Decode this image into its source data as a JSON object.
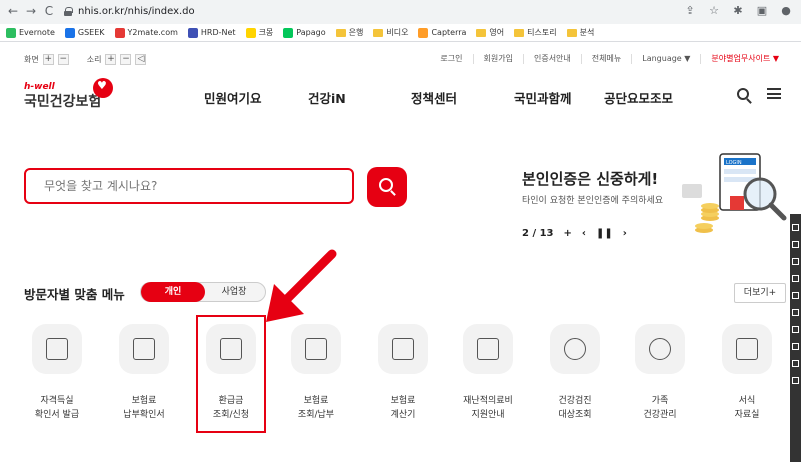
{
  "browser": {
    "back": "←",
    "forward": "→",
    "reload": "C",
    "url": "nhis.or.kr/nhis/index.do",
    "bookmarks": [
      {
        "label": "Evernote",
        "icon": "evernote-icon",
        "color": "#2dbe60"
      },
      {
        "label": "GSEEK",
        "icon": "gseek-icon",
        "color": "#1a73e8"
      },
      {
        "label": "Y2mate.com",
        "icon": "y2mate-icon",
        "color": "#e53935"
      },
      {
        "label": "HRD-Net",
        "icon": "hrdnet-icon",
        "color": "#3f51b5"
      },
      {
        "label": "크몽",
        "icon": "kmong-icon",
        "color": "#ffd400"
      },
      {
        "label": "Papago",
        "icon": "papago-icon",
        "color": "#03c75a"
      },
      {
        "label": "은행",
        "icon": "folder-icon",
        "color": "#f4c43a"
      },
      {
        "label": "비디오",
        "icon": "folder-icon",
        "color": "#f4c43a"
      },
      {
        "label": "Capterra",
        "icon": "capterra-icon",
        "color": "#ff9d28"
      },
      {
        "label": "영어",
        "icon": "folder-icon",
        "color": "#f4c43a"
      },
      {
        "label": "티스토리",
        "icon": "folder-icon",
        "color": "#f4c43a"
      },
      {
        "label": "분석",
        "icon": "folder-icon",
        "color": "#f4c43a"
      }
    ]
  },
  "util": {
    "screen_label": "화면",
    "sound_label": "소리",
    "links": [
      "로그인",
      "회원가입",
      "인증서안내",
      "전체메뉴",
      "Language ▼"
    ],
    "branch_site": "분야별업무사이트 ▼"
  },
  "header": {
    "logo_small": "h-well",
    "logo_name": "국민건강보험",
    "nav": [
      "민원여기요",
      "건강iN",
      "정책센터",
      "국민과함께",
      "공단요모조모"
    ]
  },
  "search": {
    "placeholder": "무엇을 찾고 계시나요?"
  },
  "promo": {
    "title": "본인인증은 신중하게!",
    "subtitle": "타인이 요청한 본인인증에 주의하세요",
    "page": "2",
    "total": "13",
    "art_label": "LOGIN"
  },
  "visit": {
    "title": "방문자별 맞춤 메뉴",
    "tab_personal": "개인",
    "tab_business": "사업장",
    "more": "더보기+",
    "items": [
      {
        "line1": "자격득실",
        "line2": "확인서 발급",
        "icon": "id-card-icon"
      },
      {
        "line1": "보험료",
        "line2": "납부확인서",
        "icon": "receipt-search-icon"
      },
      {
        "line1": "환급금",
        "line2": "조회/신청",
        "icon": "refund-monitor-icon"
      },
      {
        "line1": "보험료",
        "line2": "조회/납부",
        "icon": "payment-monitor-icon"
      },
      {
        "line1": "보험료",
        "line2": "계산기",
        "icon": "calculator-icon"
      },
      {
        "line1": "재난적의료비",
        "line2": "지원안내",
        "icon": "medical-support-icon"
      },
      {
        "line1": "건강검진",
        "line2": "대상조회",
        "icon": "health-check-icon"
      },
      {
        "line1": "가족",
        "line2": "건강관리",
        "icon": "family-icon"
      },
      {
        "line1": "서식",
        "line2": "자료실",
        "icon": "form-icon"
      }
    ]
  },
  "colors": {
    "brand_red": "#e60012",
    "tile_bg": "#f2f2f2"
  }
}
